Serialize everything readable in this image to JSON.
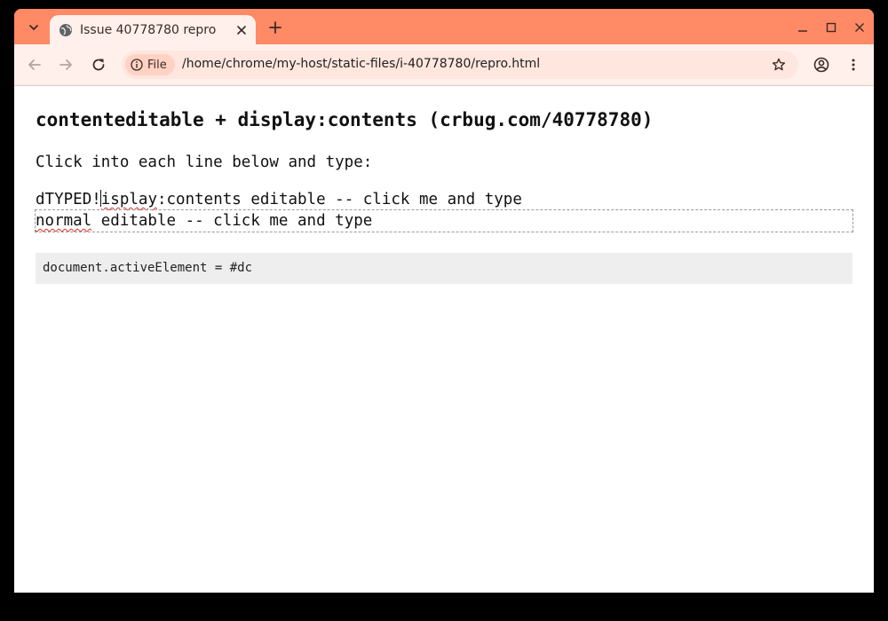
{
  "browser": {
    "tab": {
      "title": "Issue 40778780 repro",
      "favicon": "globe-icon"
    },
    "omnibox": {
      "site_chip_label": "File",
      "url": "/home/chrome/my-host/static-files/i-40778780/repro.html"
    },
    "colors": {
      "frame": "#ff8a65",
      "toolbar": "#fff0ec",
      "omnibox": "#ffe6de",
      "chip": "#ffd2c4"
    }
  },
  "page": {
    "heading": "contenteditable + display:contents (crbug.com/40778780)",
    "intro": "Click into each line below and type:",
    "line1": {
      "first_char": "d",
      "typed": "TYPED!",
      "misspelled_word": "isplay",
      "rest": ":contents editable -- click me and type"
    },
    "line2": {
      "first_word": "normal",
      "rest": " editable -- click me and type"
    },
    "status": "document.activeElement = #dc"
  }
}
